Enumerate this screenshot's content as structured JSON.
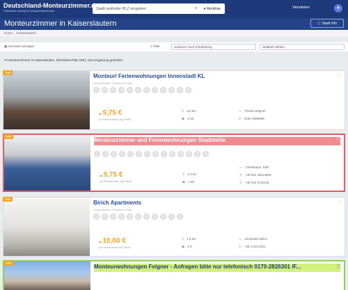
{
  "header": {
    "logo": "Deutschland-Monteurzimmer.de",
    "logo_sub": "Preiswerte Zimmer in Deutschland finden",
    "search_placeholder": "Stadt und/oder PLZ eingeben",
    "search_icon": "search-icon",
    "favorites": "♥ Merkliste",
    "vermieten": "Vermieten"
  },
  "title": {
    "text": "Monteurzimmer in Kaiserslautern",
    "info_label": "Stadt Info"
  },
  "breadcrumb": [
    "Home",
    "Kaiserslautern"
  ],
  "toolbar": {
    "map": "Auf Karte anzeigen",
    "filter": "Filter",
    "sort": "Sortieren nach Empfehlung",
    "district": "Stadtteil wählen..."
  },
  "summary": "72 Monteurzimmer in Kaiserslautern, Rheinland-Pfalz (DE), und Umgebung gefunden",
  "listings": [
    {
      "badge": "TOP",
      "title": "Monteur/ Ferienwohnungen Innenstadt KL",
      "sub": "Kaiserslautern, Rheinland-Pfalz",
      "price_prefix": "ab",
      "price": "9,75 €",
      "price_note": "pro Person/Nacht, zzgl. MwSt",
      "dist": "5,6 km",
      "persons": "1-15",
      "contact": "Florian Wagner",
      "phone": "0151-4898888"
    },
    {
      "badge": "TOP",
      "title": "Monteurzimmer und Ferienwohnungen Stadtmitte",
      "sub": "",
      "price_prefix": "ab",
      "price": "9,75 €",
      "price_note": "pro Person/Nacht, zzgl. MwSt",
      "dist": "1,3 km",
      "persons": "1-56",
      "contact": "Christmann, Ralf",
      "phone": "+49 631 43014583",
      "phone2": "+49 163 4716161"
    },
    {
      "badge": "TOP",
      "title": "Birich Apartments",
      "sub": "Kaiserslautern, Rheinland-Pfalz",
      "price_prefix": "ab",
      "price": "10,00 €",
      "price_note": "pro Person/Nacht, inkl. MwSt",
      "dist": "1,6 km",
      "persons": "1-8",
      "contact": "Alexander Birich",
      "phone": "+49 1715 2225"
    },
    {
      "badge": "TOP",
      "title": "Monteurwohnungen Feigner - Anfragen bitte nur telefonisch 0170-2826301 /F..."
    }
  ]
}
